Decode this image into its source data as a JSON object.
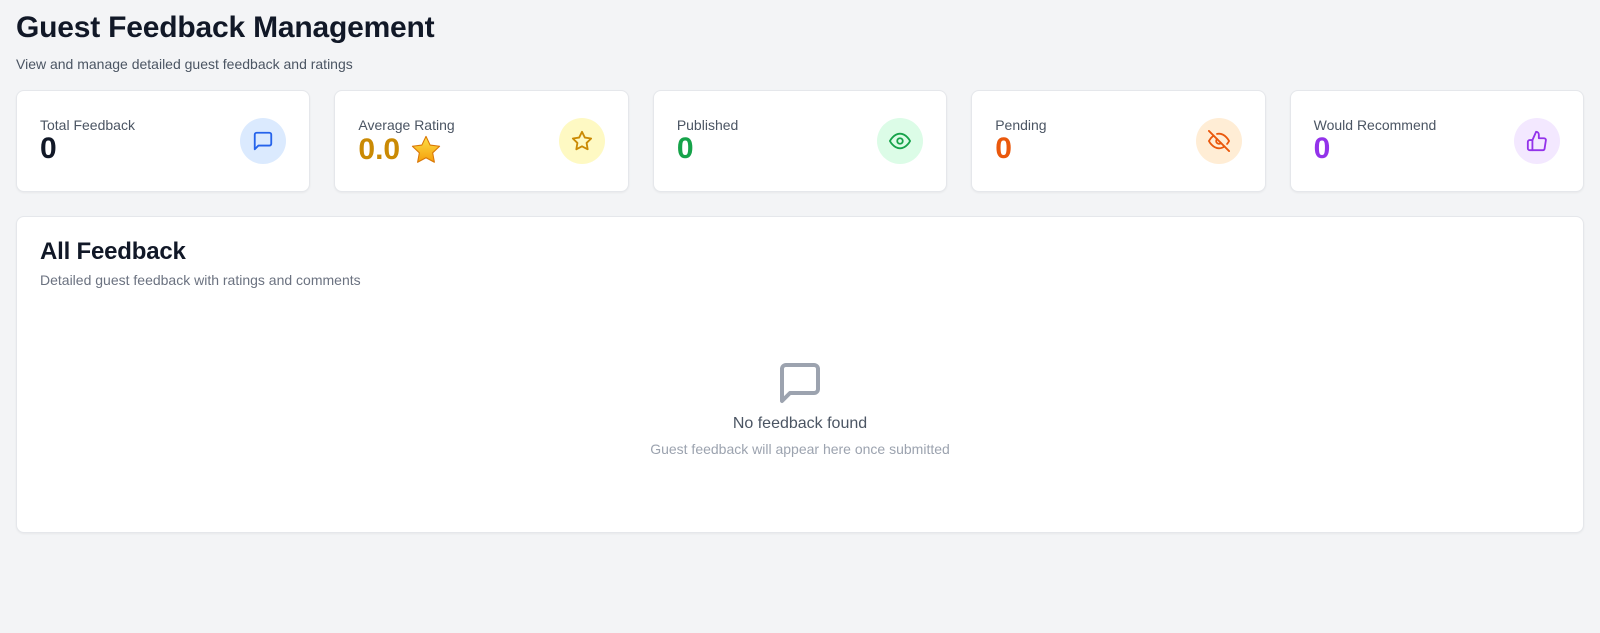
{
  "header": {
    "title": "Guest Feedback Management",
    "subtitle": "View and manage detailed guest feedback and ratings"
  },
  "stats": [
    {
      "label": "Total Feedback",
      "value": "0",
      "value_color": "#111827",
      "icon": "message-square-icon",
      "icon_color": "#2563eb",
      "icon_bg": "#dbeafe"
    },
    {
      "label": "Average Rating",
      "value": "0.0",
      "value_color": "#ca8a04",
      "icon": "star-icon",
      "icon_color": "#ca8a04",
      "icon_bg": "#fef9c3"
    },
    {
      "label": "Published",
      "value": "0",
      "value_color": "#16a34a",
      "icon": "eye-icon",
      "icon_color": "#16a34a",
      "icon_bg": "#dcfce7"
    },
    {
      "label": "Pending",
      "value": "0",
      "value_color": "#ea580c",
      "icon": "eye-off-icon",
      "icon_color": "#ea580c",
      "icon_bg": "#ffedd5"
    },
    {
      "label": "Would Recommend",
      "value": "0",
      "value_color": "#9333ea",
      "icon": "thumbs-up-icon",
      "icon_color": "#9333ea",
      "icon_bg": "#f3e8ff"
    }
  ],
  "feedback_panel": {
    "title": "All Feedback",
    "subtitle": "Detailed guest feedback with ratings and comments",
    "empty_icon": "message-square-icon",
    "empty_title": "No feedback found",
    "empty_description": "Guest feedback will appear here once submitted"
  }
}
